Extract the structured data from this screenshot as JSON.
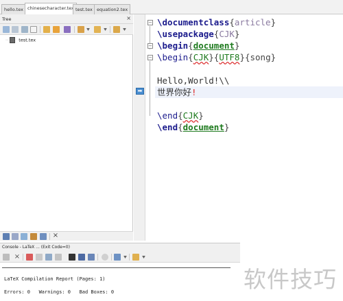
{
  "tabs": [
    {
      "label": "hello.tex",
      "active": false
    },
    {
      "label": "chinesecharacter.tex",
      "active": true
    },
    {
      "label": "test.tex",
      "active": false
    },
    {
      "label": "equation2.tex",
      "active": false
    }
  ],
  "tree": {
    "title": "Tree",
    "close_glyph": "×",
    "file": {
      "label": "test.tex",
      "icon": "tex-file-icon"
    }
  },
  "editor": {
    "line1": {
      "cmd": "\\documentclass",
      "open": "{",
      "arg": "article",
      "close": "}"
    },
    "line2": {
      "cmd": "\\usepackage",
      "open": "{",
      "arg": "CJK",
      "close": "}"
    },
    "line3": {
      "cmd": "\\begin",
      "open": "{",
      "arg": "document",
      "close": "}"
    },
    "line4": {
      "cmd": "\\begin",
      "open": "{",
      "arg1": "CJK",
      "mid": "}{",
      "arg2": "UTF8",
      "tail": "}{song}"
    },
    "line6": {
      "text": "Hello,World!\\\\"
    },
    "line7": {
      "text": "世界你好",
      "punct": "!"
    },
    "line9": {
      "cmd": "\\end",
      "open": "{",
      "arg": "CJK",
      "close": "}"
    },
    "line10": {
      "cmd": "\\end",
      "open": "{",
      "arg": "document",
      "close": "}"
    },
    "fold_glyph": "−",
    "marker_glyph": "➡"
  },
  "console": {
    "title": "Console - LaTeX ... (Exit Code=0)",
    "close_glyph": "×",
    "report": "LaTeX Compilation Report (Pages: 1)",
    "summary": "Errors: 0   Warnings: 0   Bad Boxes: 0"
  },
  "watermark": "软件技巧",
  "colors": {
    "keyword": "#1b1b8c",
    "argument": "#1e7a1e",
    "highlight_line": "#eef2fb",
    "marker": "#4b8fd1"
  }
}
